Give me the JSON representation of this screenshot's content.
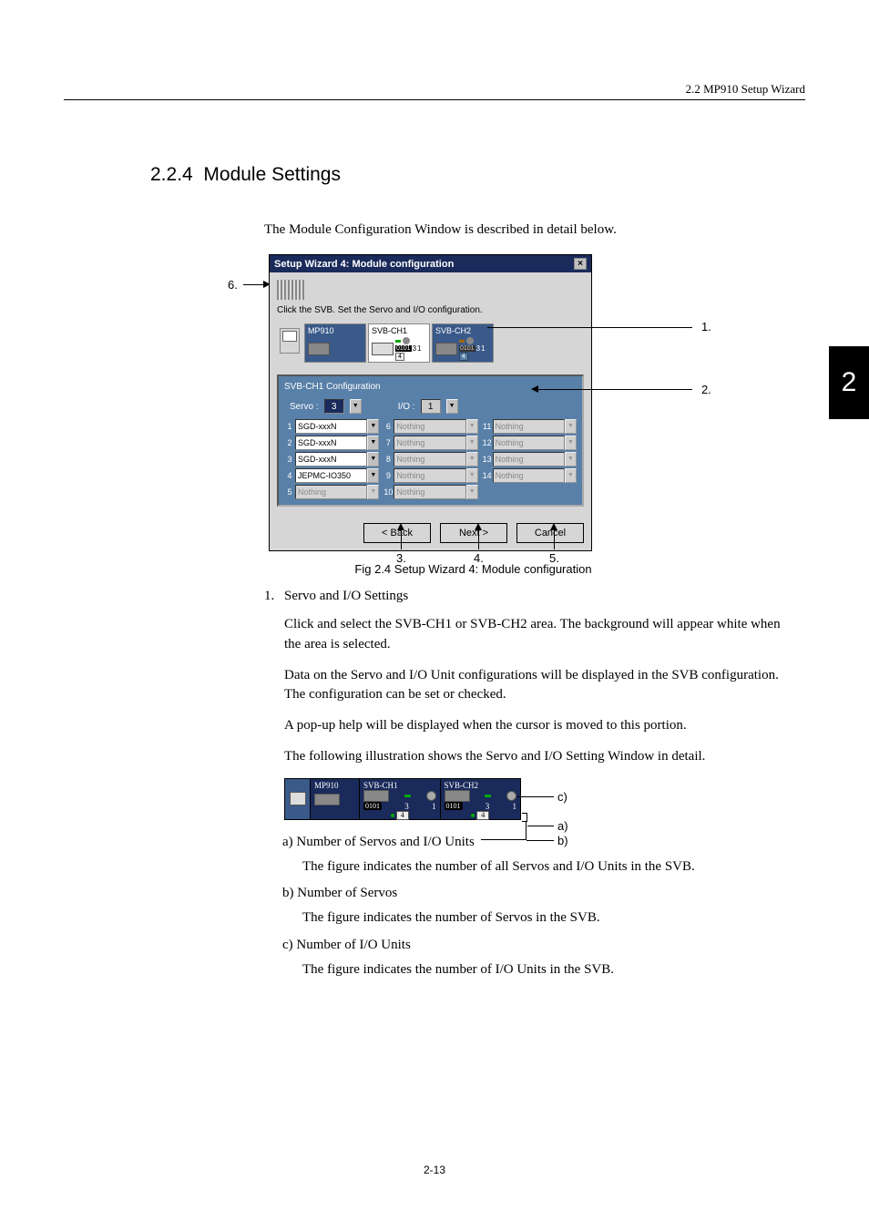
{
  "header": {
    "right": "2.2  MP910 Setup Wizard"
  },
  "section": {
    "number": "2.2.4",
    "title": "Module Settings"
  },
  "intro": "The Module Configuration Window is described in detail below.",
  "dialog": {
    "title": "Setup Wizard  4: Module configuration",
    "instruction": "Click the SVB. Set the Servo and I/O configuration.",
    "modules": {
      "mp910": "MP910",
      "ch1": "SVB-CH1",
      "ch2": "SVB-CH2",
      "ch1_num1": "3",
      "ch1_num2": "1",
      "ch1_num3": "4",
      "ch2_num1": "3",
      "ch2_num2": "1",
      "ch2_num3": "4"
    },
    "config": {
      "title": "SVB-CH1 Configuration",
      "servo_label": "Servo :",
      "servo_val": "3",
      "io_label": "I/O :",
      "io_val": "1"
    },
    "slots": [
      {
        "n": "1",
        "v": "SGD-xxxN",
        "en": true
      },
      {
        "n": "2",
        "v": "SGD-xxxN",
        "en": true
      },
      {
        "n": "3",
        "v": "SGD-xxxN",
        "en": true
      },
      {
        "n": "4",
        "v": "JEPMC-IO350",
        "en": true
      },
      {
        "n": "5",
        "v": "Nothing",
        "en": false
      },
      {
        "n": "6",
        "v": "Nothing",
        "en": false
      },
      {
        "n": "7",
        "v": "Nothing",
        "en": false
      },
      {
        "n": "8",
        "v": "Nothing",
        "en": false
      },
      {
        "n": "9",
        "v": "Nothing",
        "en": false
      },
      {
        "n": "10",
        "v": "Nothing",
        "en": false
      },
      {
        "n": "11",
        "v": "Nothing",
        "en": false
      },
      {
        "n": "12",
        "v": "Nothing",
        "en": false
      },
      {
        "n": "13",
        "v": "Nothing",
        "en": false
      },
      {
        "n": "14",
        "v": "Nothing",
        "en": false
      }
    ],
    "buttons": {
      "back": "< Back",
      "next": "Next >",
      "cancel": "Cancel"
    }
  },
  "figcaption": "Fig 2.4  Setup Wizard 4: Module configuration",
  "callouts": {
    "c1": "1.",
    "c2": "2.",
    "c3": "3.",
    "c4": "4.",
    "c5": "5.",
    "c6": "6."
  },
  "list": {
    "num": "1.",
    "heading": "Servo and I/O Settings",
    "p1": "Click and select the SVB-CH1 or SVB-CH2 area. The background will appear white when the area is selected.",
    "p2": "Data on the Servo and I/O Unit configurations will be displayed in the SVB configuration. The configuration can be set or checked.",
    "p3": "A pop-up help will be displayed when the cursor is moved to this portion.",
    "p4": "The following illustration shows the Servo and I/O Setting Window in detail."
  },
  "svb": {
    "mp910": "MP910",
    "ch1": "SVB-CH1",
    "ch2": "SVB-CH2",
    "io": "0101",
    "n3": "3",
    "n1": "1",
    "n4": "4"
  },
  "sub": {
    "a_head": "a) Number of Servos and I/O Units",
    "a_body": "The figure indicates the number of all Servos and I/O Units in the SVB.",
    "b_head": "b) Number of Servos",
    "b_body": "The figure indicates the number of Servos in the SVB.",
    "c_head": "c) Number of I/O Units",
    "c_body": "The figure indicates the number of I/O Units in the SVB."
  },
  "svb_callouts": {
    "a": "a)",
    "b": "b)",
    "c": "c)"
  },
  "sidetab": "2",
  "pagenum": "2-13"
}
